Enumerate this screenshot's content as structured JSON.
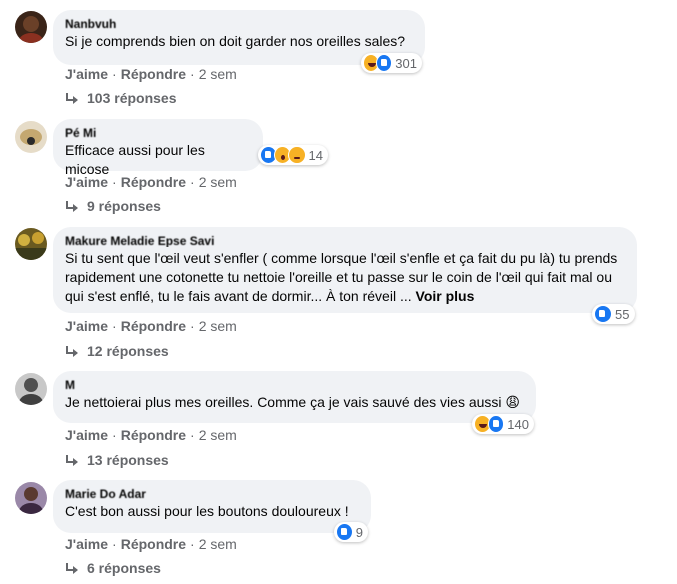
{
  "comments": [
    {
      "author": "Nanbvuh",
      "text": "Si je comprends bien on doit garder nos oreilles sales?",
      "reactions": [
        "haha-icon",
        "like-icon"
      ],
      "reaction_count": "301",
      "like": "J'aime",
      "reply": "Répondre",
      "time": "2 sem",
      "replies": "103 réponses",
      "avatar_color": "#5a3a2a"
    },
    {
      "author": "Pé Mi",
      "text": "Efficace aussi pour les micose",
      "reactions": [
        "like-icon",
        "wow-icon",
        "sad-icon"
      ],
      "reaction_count": "14",
      "like": "J'aime",
      "reply": "Répondre",
      "time": "2 sem",
      "replies": "9 réponses",
      "avatar_color": "#c8b89a"
    },
    {
      "author": "Makure Meladie Epse Savi",
      "text": "Si tu sent que l'œil veut s'enfler ( comme lorsque l'œil s'enfle et ça fait du pu là) tu prends rapidement une cotonette tu nettoie l'oreille et tu passe sur le coin de l'œil qui fait mal ou qui s'est enflé, tu le fais avant de dormir... À ton réveil ...",
      "see_more": "Voir plus",
      "reactions": [
        "like-icon"
      ],
      "reaction_count": "55",
      "like": "J'aime",
      "reply": "Répondre",
      "time": "2 sem",
      "replies": "12 réponses",
      "avatar_color": "#b89a3a"
    },
    {
      "author": "M",
      "text": "Je nettoierai plus mes oreilles. Comme ça je vais sauvé des vies aussi 😩",
      "reactions": [
        "haha-icon",
        "like-icon"
      ],
      "reaction_count": "140",
      "like": "J'aime",
      "reply": "Répondre",
      "time": "2 sem",
      "replies": "13 réponses",
      "avatar_color": "#707070"
    },
    {
      "author": "Marie Do Adar",
      "text": "C'est bon aussi pour les boutons douloureux !",
      "reactions": [
        "like-icon"
      ],
      "reaction_count": "9",
      "like": "J'aime",
      "reply": "Répondre",
      "time": "2 sem",
      "replies": "6 réponses",
      "avatar_color": "#8a7090"
    }
  ]
}
